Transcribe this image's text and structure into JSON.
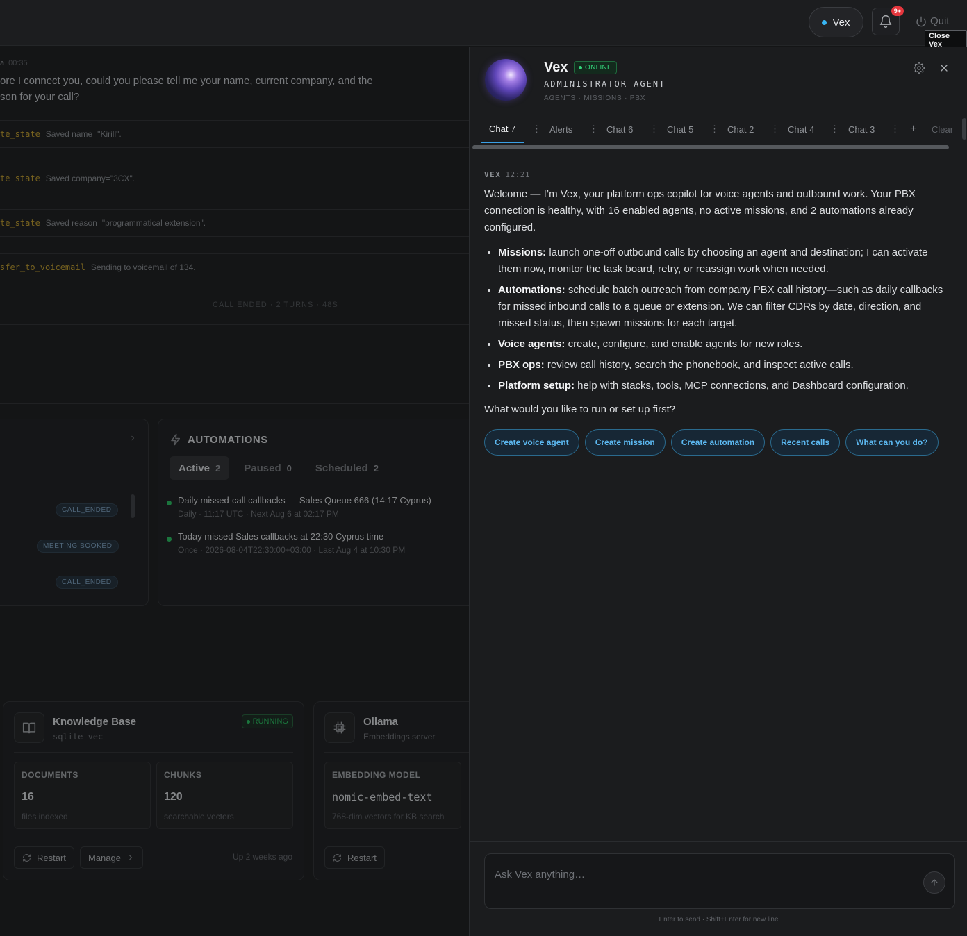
{
  "topbar": {
    "vex_button": "Vex",
    "notifications_badge": "9+",
    "quit_label": "Quit",
    "tooltip": "Close Vex"
  },
  "background": {
    "message": {
      "speaker": "a",
      "time": "00:35",
      "text": "ore I connect you, could you please tell me your name, current company, and the son for your call?"
    },
    "tool_calls": [
      {
        "fn": "te_state",
        "desc": "Saved name=\"Kirill\"."
      },
      {
        "fn": "te_state",
        "desc": "Saved company=\"3CX\"."
      },
      {
        "fn": "te_state",
        "desc": "Saved reason=\"programmatical extension\"."
      },
      {
        "fn": "sfer_to_voicemail",
        "desc": "Sending to voicemail of 134."
      }
    ],
    "call_summary": "CALL ENDED · 2 TURNS · 48S",
    "call_tags": [
      "CALL_ENDED",
      "MEETING BOOKED",
      "CALL_ENDED"
    ],
    "automations": {
      "title": "AUTOMATIONS",
      "tabs": [
        {
          "label": "Active",
          "count": "2"
        },
        {
          "label": "Paused",
          "count": "0"
        },
        {
          "label": "Scheduled",
          "count": "2"
        }
      ],
      "items": [
        {
          "title": "Daily missed-call callbacks — Sales Queue 666 (14:17 Cyprus)",
          "sub": "Daily · 11:17 UTC · Next Aug 6 at 02:17 PM"
        },
        {
          "title": "Today missed Sales callbacks at 22:30 Cyprus time",
          "sub": "Once · 2026-08-04T22:30:00+03:00 · Last Aug 4 at 10:30 PM"
        }
      ]
    },
    "knowledge_base": {
      "name": "Knowledge Base",
      "sub": "sqlite-vec",
      "status": "RUNNING",
      "documents_label": "DOCUMENTS",
      "documents_value": "16",
      "documents_desc": "files indexed",
      "chunks_label": "CHUNKS",
      "chunks_value": "120",
      "chunks_desc": "searchable vectors",
      "restart": "Restart",
      "manage": "Manage",
      "uptime": "Up 2 weeks ago"
    },
    "ollama": {
      "name": "Ollama",
      "sub": "Embeddings server",
      "model_label": "EMBEDDING MODEL",
      "model_value": "nomic-embed-text",
      "model_desc": "768-dim vectors for KB search",
      "restart": "Restart"
    }
  },
  "panel": {
    "name": "Vex",
    "status": "ONLINE",
    "role": "ADMINISTRATOR AGENT",
    "subrole": "AGENTS · MISSIONS · PBX",
    "tabs": [
      "Chat 7",
      "Alerts",
      "Chat 6",
      "Chat 5",
      "Chat 2",
      "Chat 4",
      "Chat 3"
    ],
    "add_tab": "+",
    "clear": "Clear",
    "message": {
      "sender": "VEX",
      "time": "12:21",
      "intro": "Welcome — I’m Vex, your platform ops copilot for voice agents and outbound work. Your PBX connection is healthy, with 16 enabled agents, no active missions, and 2 automations already configured.",
      "bullets": [
        {
          "head": "Missions:",
          "text": " launch one-off outbound calls by choosing an agent and destination; I can activate them now, monitor the task board, retry, or reassign work when needed."
        },
        {
          "head": "Automations:",
          "text": " schedule batch outreach from company PBX call history—such as daily callbacks for missed inbound calls to a queue or extension. We can filter CDRs by date, direction, and missed status, then spawn missions for each target."
        },
        {
          "head": "Voice agents:",
          "text": " create, configure, and enable agents for new roles."
        },
        {
          "head": "PBX ops:",
          "text": " review call history, search the phonebook, and inspect active calls."
        },
        {
          "head": "Platform setup:",
          "text": " help with stacks, tools, MCP connections, and Dashboard configuration."
        }
      ],
      "question": "What would you like to run or set up first?"
    },
    "chips": [
      "Create voice agent",
      "Create mission",
      "Create automation",
      "Recent calls",
      "What can you do?"
    ],
    "composer_placeholder": "Ask Vex anything…",
    "hint": "Enter to send · Shift+Enter for new line"
  }
}
